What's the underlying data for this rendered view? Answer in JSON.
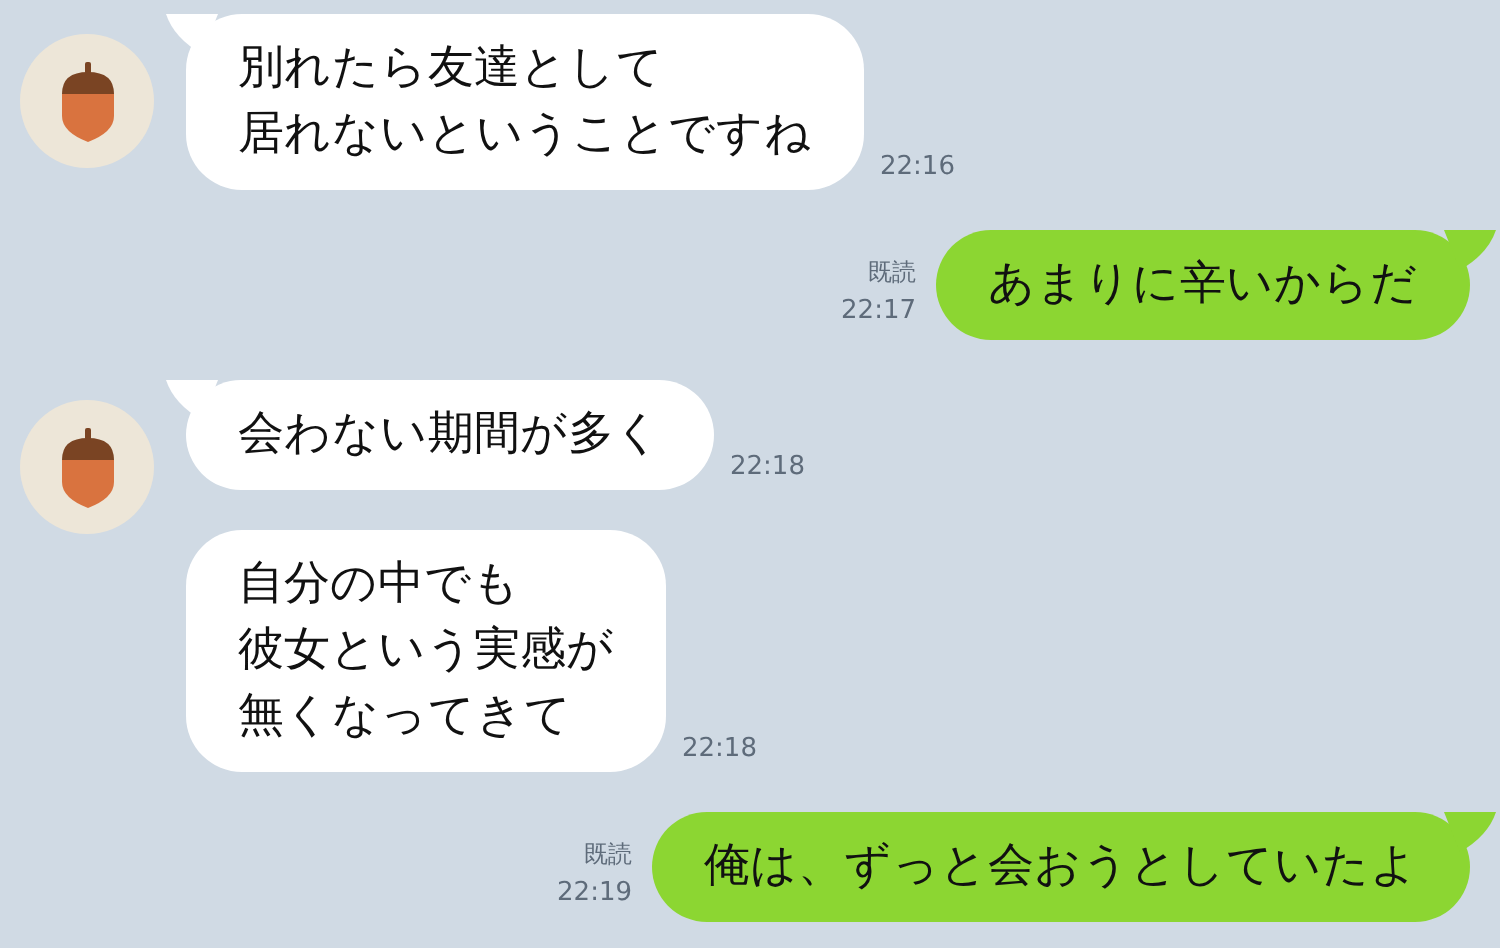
{
  "messages": [
    {
      "kind": "received",
      "tail": true,
      "lines": [
        "別れたら友達として",
        "居れないということですね"
      ],
      "time": "22:16"
    },
    {
      "kind": "sent",
      "tail": true,
      "lines": [
        "あまりに辛いからだ"
      ],
      "read_label": "既読",
      "time": "22:17"
    },
    {
      "kind": "received",
      "tail": true,
      "lines": [
        "会わない期間が多く"
      ],
      "time": "22:18"
    },
    {
      "kind": "received",
      "tail": false,
      "lines": [
        "自分の中でも",
        "彼女という実感が",
        "無くなってきて"
      ],
      "time": "22:18"
    },
    {
      "kind": "sent",
      "tail": true,
      "lines": [
        "俺は、ずっと会おうとしていたよ"
      ],
      "read_label": "既読",
      "time": "22:19"
    }
  ]
}
